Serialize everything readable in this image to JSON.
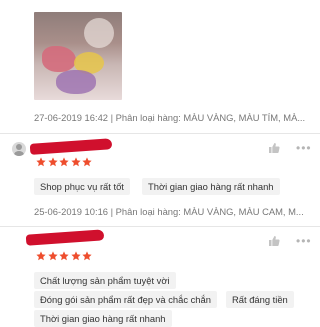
{
  "reviews": [
    {
      "date_variant": "27-06-2019 16:42 | Phân loại hàng: MÀU VÀNG, MÀU TÍM, MÀ...",
      "rating": 5,
      "tags": [
        "Shop phục vụ rất tốt",
        "Thời gian giao hàng rất nhanh"
      ]
    },
    {
      "date_variant": "25-06-2019 10:16 | Phân loại hàng: MÀU VÀNG, MÀU CAM, M...",
      "rating": 5,
      "tags": [
        "Chất lượng sản phẩm tuyệt vời",
        "Đóng gói sản phẩm rất đẹp và chắc chắn",
        "Rất đáng tiền",
        "Thời gian giao hàng rất nhanh"
      ]
    }
  ],
  "icons": {
    "star_color": "#ee4d2d",
    "like": "thumbs-up-icon",
    "more": "more-options-icon"
  },
  "colors": {
    "redaction": "#d0102d",
    "meta_text": "#777777",
    "tag_bg": "#f2f2f2"
  }
}
